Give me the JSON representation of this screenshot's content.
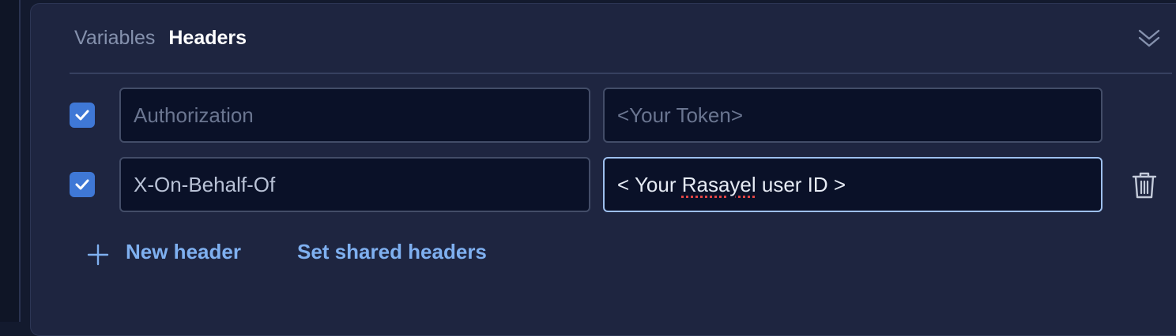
{
  "tabs": [
    {
      "label": "Variables",
      "active": false
    },
    {
      "label": "Headers",
      "active": true
    }
  ],
  "headers": [
    {
      "enabled": true,
      "key": {
        "value": "",
        "placeholder": "Authorization"
      },
      "value": {
        "value": "",
        "placeholder": "<Your Token>"
      }
    },
    {
      "enabled": true,
      "key": {
        "value": "X-On-Behalf-Of",
        "placeholder": ""
      },
      "value": {
        "value_prefix": "< Your ",
        "value_misspelled": "Rasayel",
        "value_suffix": " user ID >",
        "focused": true
      }
    }
  ],
  "actions": {
    "new_header": "New header",
    "set_shared": "Set shared headers"
  },
  "icons": {
    "collapse": "double-chevron-down-icon",
    "checkbox": "checkmark-icon",
    "delete": "trash-icon",
    "add": "plus-icon"
  },
  "colors": {
    "accent": "#3f78d6",
    "link": "#7fb0f0",
    "panel": "#1e2540",
    "input_bg": "#0a1128",
    "focus_border": "#9ec0ee"
  }
}
